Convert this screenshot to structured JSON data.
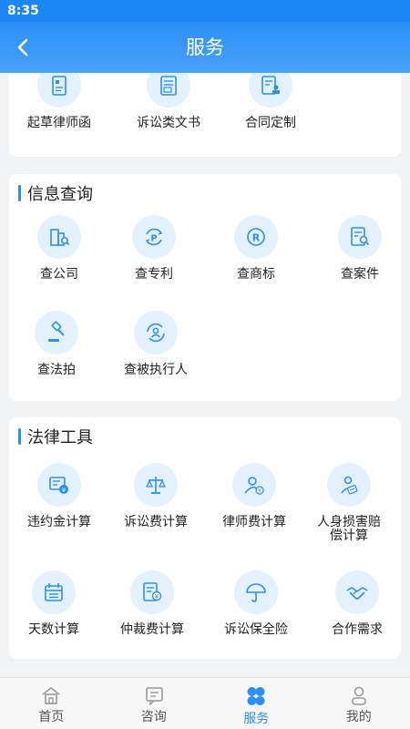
{
  "status_bar": {
    "time": "8:35"
  },
  "header": {
    "title": "服务"
  },
  "partial_section": {
    "items": [
      {
        "label": "起草律师函",
        "icon": "letter-doc-icon"
      },
      {
        "label": "诉讼类文书",
        "icon": "litigation-doc-icon"
      },
      {
        "label": "合同定制",
        "icon": "contract-stamp-icon"
      }
    ]
  },
  "info_section": {
    "title": "信息查询",
    "items": [
      {
        "label": "查公司",
        "icon": "company-search-icon"
      },
      {
        "label": "查专利",
        "icon": "patent-icon"
      },
      {
        "label": "查商标",
        "icon": "trademark-icon"
      },
      {
        "label": "查案件",
        "icon": "case-search-icon"
      },
      {
        "label": "查法拍",
        "icon": "gavel-icon"
      },
      {
        "label": "查被执行人",
        "icon": "person-refresh-icon"
      }
    ]
  },
  "tools_section": {
    "title": "法律工具",
    "items": [
      {
        "label": "违约金计算",
        "icon": "penalty-calc-icon"
      },
      {
        "label": "诉讼费计算",
        "icon": "scale-icon"
      },
      {
        "label": "律师费计算",
        "icon": "lawyer-fee-icon"
      },
      {
        "label": "人身损害赔偿计算",
        "label_line1": "人身损害赔",
        "label_line2": "偿计算",
        "icon": "injury-calc-icon"
      },
      {
        "label": "天数计算",
        "icon": "calendar-icon"
      },
      {
        "label": "仲裁费计算",
        "icon": "arbitration-fee-icon"
      },
      {
        "label": "诉讼保全险",
        "icon": "umbrella-icon"
      },
      {
        "label": "合作需求",
        "icon": "handshake-icon"
      }
    ]
  },
  "tabbar": {
    "tabs": [
      {
        "label": "首页",
        "icon": "home-icon"
      },
      {
        "label": "咨询",
        "icon": "chat-icon"
      },
      {
        "label": "服务",
        "icon": "service-icon",
        "active": true
      },
      {
        "label": "我的",
        "icon": "profile-icon"
      }
    ]
  },
  "colors": {
    "accent": "#2a8ff6",
    "icon_bg": "#e4f1fe",
    "page_bg": "#f2f3f5"
  }
}
